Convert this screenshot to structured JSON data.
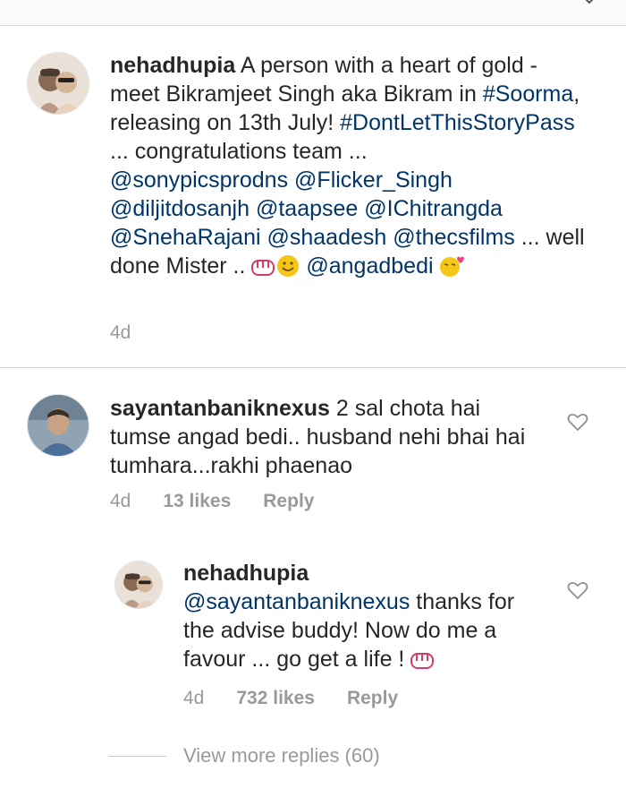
{
  "post_comment": {
    "username": "nehadhupia",
    "text_plain_1": " A  person with a heart of gold - meet Bikramjeet Singh aka Bikram in ",
    "hashtag_1": "#Soorma",
    "text_plain_2": ", releasing on 13th July! ",
    "hashtag_2": "#DontLetThisStoryPass",
    "text_plain_3": " ... congratulations team ... ",
    "mentions": [
      "@sonypicsprodns",
      "@Flicker_Singh",
      "@diljitdosanjh",
      "@taapsee",
      "@IChitrangda",
      "@SnehaRajani",
      "@shaadesh",
      "@thecsfilms"
    ],
    "text_plain_4": " ... well done Mister .. ",
    "mention_last": "@angadbedi",
    "time": "4d"
  },
  "comment_1": {
    "username": "sayantanbaniknexus",
    "text": " 2 sal chota hai tumse angad bedi.. husband nehi bhai hai tumhara...rakhi phaenao",
    "time": "4d",
    "likes": "13 likes",
    "reply": "Reply"
  },
  "reply_1": {
    "username": "nehadhupia",
    "mention": "@sayantanbaniknexus",
    "text": " thanks for the advise buddy! Now do me a favour ... go get a life ! ",
    "time": "4d",
    "likes": "732 likes",
    "reply": "Reply"
  },
  "view_more": "View more replies (60)",
  "icons": {
    "heart": "heart-outline-icon",
    "chevron": "chevron-down-icon"
  },
  "colors": {
    "link": "#003569",
    "meta": "#999999"
  }
}
